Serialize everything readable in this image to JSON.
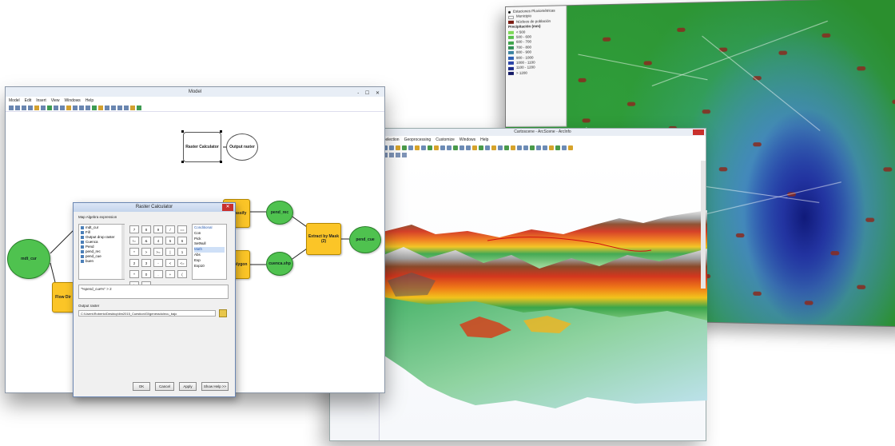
{
  "map": {
    "legend": {
      "items": [
        {
          "label": "Estaciones Pluviométricas",
          "color": "#111111"
        },
        {
          "label": "Municipio",
          "color": "#ffffff"
        },
        {
          "label": "Núcleos de población",
          "color": "#7a1a10"
        }
      ],
      "header": "Precipitación (mm)",
      "classes": [
        {
          "label": "< 500",
          "color": "#7ed957"
        },
        {
          "label": "500 - 600",
          "color": "#56c04a"
        },
        {
          "label": "600 - 700",
          "color": "#3ea54a"
        },
        {
          "label": "700 - 800",
          "color": "#2f8e54"
        },
        {
          "label": "800 - 900",
          "color": "#3b83a0"
        },
        {
          "label": "900 - 1000",
          "color": "#2e5fb4"
        },
        {
          "label": "1000 - 1100",
          "color": "#2a43a8"
        },
        {
          "label": "1100 - 1200",
          "color": "#1d2c8a"
        },
        {
          "label": "> 1200",
          "color": "#141a66"
        }
      ]
    }
  },
  "scene": {
    "title": "Cartoscene - ArcScene - ArcInfo",
    "menu": [
      "Selection",
      "Geoprocessing",
      "Customize",
      "Windows",
      "Help"
    ]
  },
  "model": {
    "title": "Model",
    "window_controls": "- ☐ ✕",
    "menu": [
      "Model",
      "Edit",
      "Insert",
      "View",
      "Windows",
      "Help"
    ],
    "nodes": {
      "raster_calculator": "Raster Calculator",
      "output_raster": "Output raster",
      "mdt_cur": "mdt_cur",
      "flow_dir": "Flow Dir",
      "reclassify": "Reclassify",
      "pend_rec": "pend_rec",
      "to_polygon": "To Polygon",
      "cuenca_shp": "cuenca.shp",
      "extract_by_mask": "Extract by Mask (2)",
      "pend_cue": "pend_cue"
    },
    "dialog": {
      "title": "Raster Calculator",
      "map_algebra_label": "Map Algebra expression",
      "layers": [
        "mdt_cur",
        "Fill",
        "Output drop raster",
        "Cuenca",
        "Pend",
        "pend_rec",
        "pend_cue",
        "buen"
      ],
      "keypad": [
        "7",
        "8",
        "9",
        "/",
        "==",
        "!=",
        "&",
        "4",
        "5",
        "6",
        "*",
        ">",
        ">=",
        "|",
        "1",
        "2",
        "3",
        "-",
        "<",
        "<=",
        "^",
        "0",
        ".",
        "+",
        "(",
        ")",
        "~"
      ],
      "functions": [
        {
          "label": "Conditional",
          "type": "cat"
        },
        {
          "label": "Con",
          "type": "item"
        },
        {
          "label": "Pick",
          "type": "item"
        },
        {
          "label": "SetNull",
          "type": "item"
        },
        {
          "label": "Math",
          "type": "cat"
        },
        {
          "label": "Abs",
          "type": "item"
        },
        {
          "label": "Exp",
          "type": "item"
        },
        {
          "label": "Exp10",
          "type": "item"
        }
      ],
      "expression": "\"%pend_cue%\" > 2",
      "output_label": "Output raster",
      "output_value": "C:\\Users\\Roberto\\Desktop\\lim2015_Cuestion\\Gl\\generado\\ecu_bajo",
      "buttons": {
        "ok": "OK",
        "cancel": "Cancel",
        "apply": "Apply",
        "help": "Show Help >>"
      }
    }
  }
}
